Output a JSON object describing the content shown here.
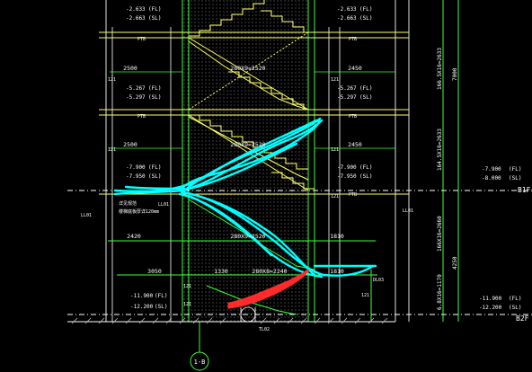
{
  "drawing": {
    "elevations_left": [
      {
        "fl": "-2.633",
        "sl": "-2.663",
        "fl_tag": "(FL)",
        "sl_tag": "(SL)"
      },
      {
        "fl": "-5.267",
        "sl": "-5.297",
        "fl_tag": "(FL)",
        "sl_tag": "(SL)"
      },
      {
        "fl": "-7.900",
        "sl": "-7.950",
        "fl_tag": "(FL)",
        "sl_tag": "(SL)"
      },
      {
        "fl": "-11.900",
        "sl": "-12.200",
        "fl_tag": "(FL)",
        "sl_tag": "(SL)"
      }
    ],
    "elevations_right": [
      {
        "fl": "-2.633",
        "sl": "-2.663",
        "fl_tag": "(FL)",
        "sl_tag": "(SL)"
      },
      {
        "fl": "-5.267",
        "sl": "-5.297",
        "fl_tag": "(FL)",
        "sl_tag": "(SL)"
      },
      {
        "fl": "-7.900",
        "sl": "-7.950",
        "fl_tag": "(FL)",
        "sl_tag": "(SL)"
      },
      {
        "fl": "-7.900",
        "sl": "-8.000",
        "fl_tag": "(FL)",
        "sl_tag": "(SL)"
      },
      {
        "fl": "-11.900",
        "sl": "-12.200",
        "fl_tag": "(FL)",
        "sl_tag": "(SL)"
      }
    ],
    "dims_left": [
      "2500",
      "2500",
      "2420",
      "3050"
    ],
    "dims_right": [
      "2450",
      "2450",
      "1810",
      "1810"
    ],
    "dim_mid": [
      "1330"
    ],
    "stair_labels": [
      "280X9=2520",
      "280X9=2520",
      "280X9=2520",
      "280X8=2240"
    ],
    "vertical_dims": [
      "166.5X16=2633",
      "164.5X16=2633",
      "166X16=2660",
      "6.8X16=1170",
      "7000",
      "4250"
    ],
    "small_tags": [
      "PTB",
      "PTB",
      "PTB",
      "PTB",
      "121",
      "121",
      "121",
      "121",
      "121",
      "121",
      "121",
      "121"
    ],
    "small_tag_right": "PTB",
    "notes": [
      "详见规范",
      "楼梯底板厚详120mm"
    ],
    "callouts": [
      "LL01",
      "LL01",
      "LL01",
      "DL03",
      "TL02"
    ],
    "side_tags": [
      "B1F",
      "B2F"
    ],
    "axis_label": "1-B"
  }
}
